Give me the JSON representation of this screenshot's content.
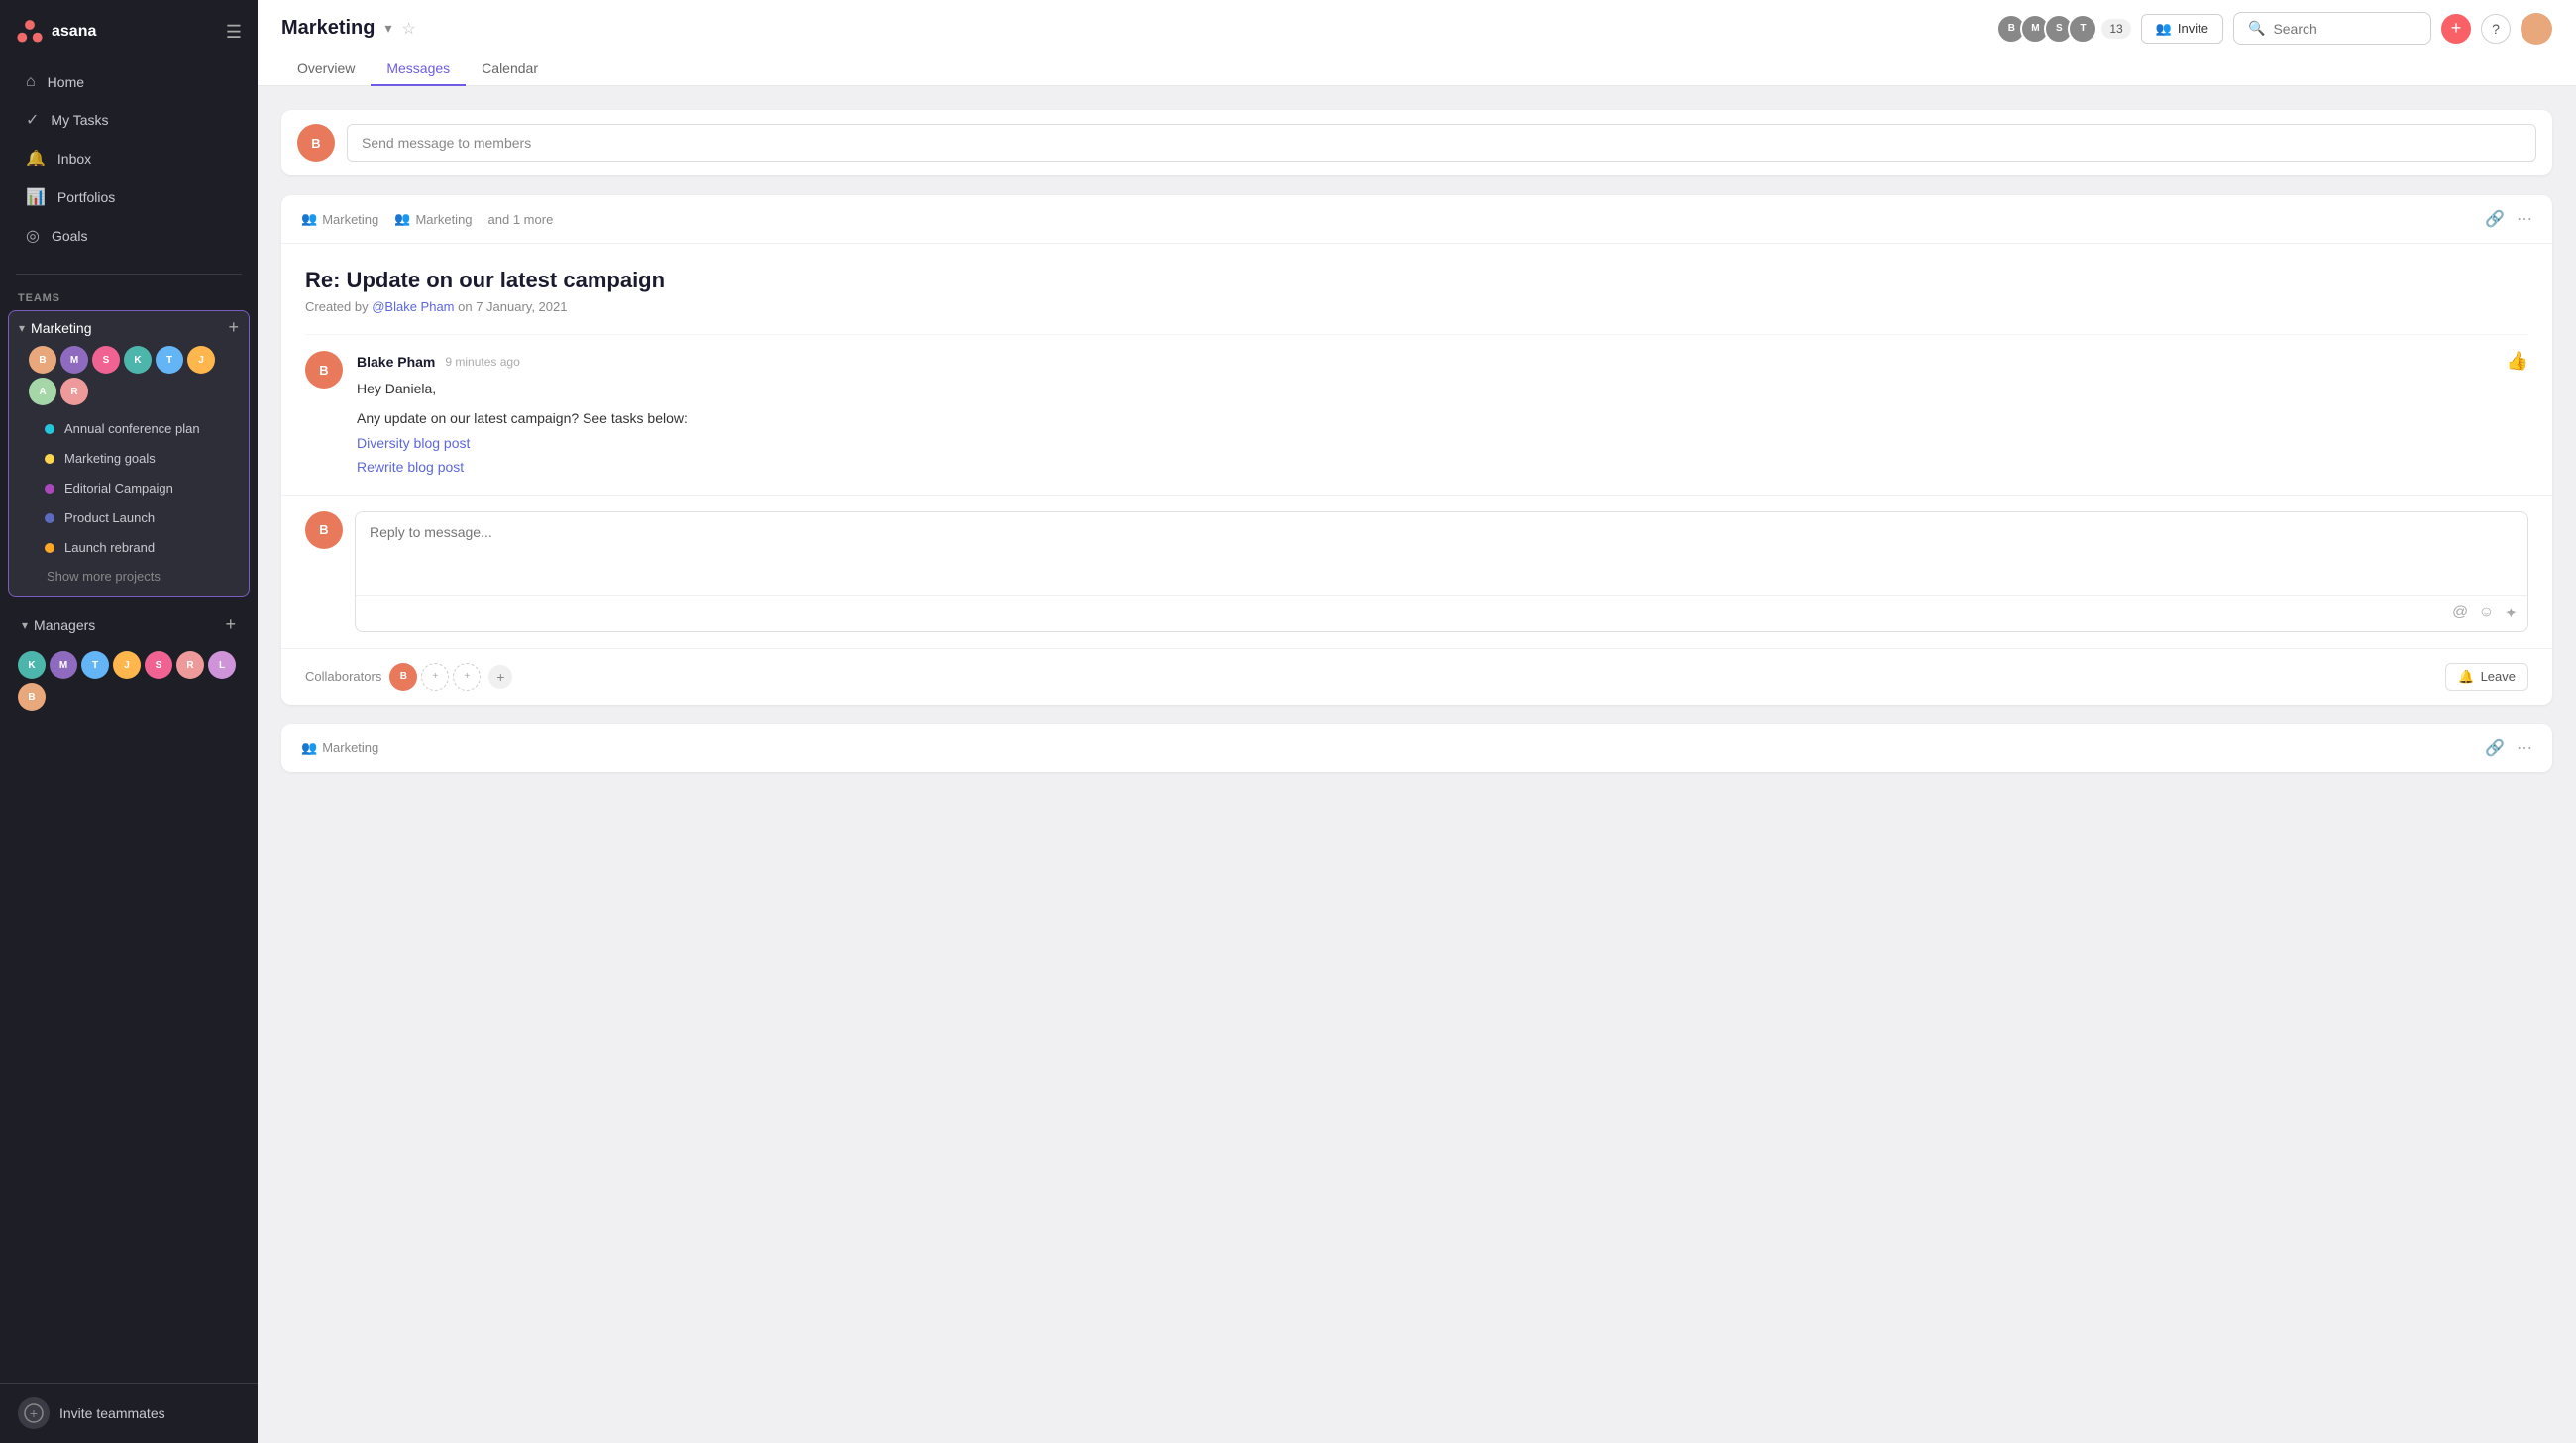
{
  "app": {
    "name": "asana",
    "logo_text": "asana"
  },
  "sidebar": {
    "nav": [
      {
        "id": "home",
        "label": "Home",
        "icon": "⌂"
      },
      {
        "id": "my-tasks",
        "label": "My Tasks",
        "icon": "✓"
      },
      {
        "id": "inbox",
        "label": "Inbox",
        "icon": "🔔"
      },
      {
        "id": "portfolios",
        "label": "Portfolios",
        "icon": "📊"
      },
      {
        "id": "goals",
        "label": "Goals",
        "icon": "◎"
      }
    ],
    "teams_label": "Teams",
    "teams": [
      {
        "id": "marketing",
        "label": "Marketing",
        "active": true,
        "projects": [
          {
            "id": "annual",
            "label": "Annual conference plan",
            "dot": "teal"
          },
          {
            "id": "goals",
            "label": "Marketing goals",
            "dot": "yellow"
          },
          {
            "id": "editorial",
            "label": "Editorial Campaign",
            "dot": "purple"
          },
          {
            "id": "launch",
            "label": "Product Launch",
            "dot": "blue"
          },
          {
            "id": "rebrand",
            "label": "Launch rebrand",
            "dot": "orange"
          }
        ]
      },
      {
        "id": "managers",
        "label": "Managers",
        "active": false
      }
    ],
    "show_more": "Show more projects",
    "invite_label": "Invite teammates"
  },
  "topbar": {
    "project_title": "Marketing",
    "tabs": [
      {
        "id": "overview",
        "label": "Overview",
        "active": false
      },
      {
        "id": "messages",
        "label": "Messages",
        "active": true
      },
      {
        "id": "calendar",
        "label": "Calendar",
        "active": false
      }
    ],
    "member_count": "13",
    "invite_btn": "Invite",
    "search_placeholder": "Search",
    "add_btn": "+",
    "help_btn": "?"
  },
  "compose": {
    "placeholder": "Send message to members"
  },
  "thread": {
    "meta1": "Marketing",
    "meta2": "Marketing",
    "meta3": "and 1 more",
    "subject": "Re: Update on our latest campaign",
    "created_prefix": "Created by",
    "created_by": "@Blake Pham",
    "created_date": "on 7 January, 2021",
    "message": {
      "author": "Blake Pham",
      "time": "9 minutes ago",
      "greeting": "Hey Daniela,",
      "body": "Any update on our latest campaign? See tasks below:",
      "link1": "Diversity blog post",
      "link2": "Rewrite blog post"
    },
    "reply_placeholder": "Reply to message...",
    "collaborators_label": "Collaborators",
    "leave_btn": "Leave"
  },
  "thread2": {
    "meta": "Marketing"
  }
}
